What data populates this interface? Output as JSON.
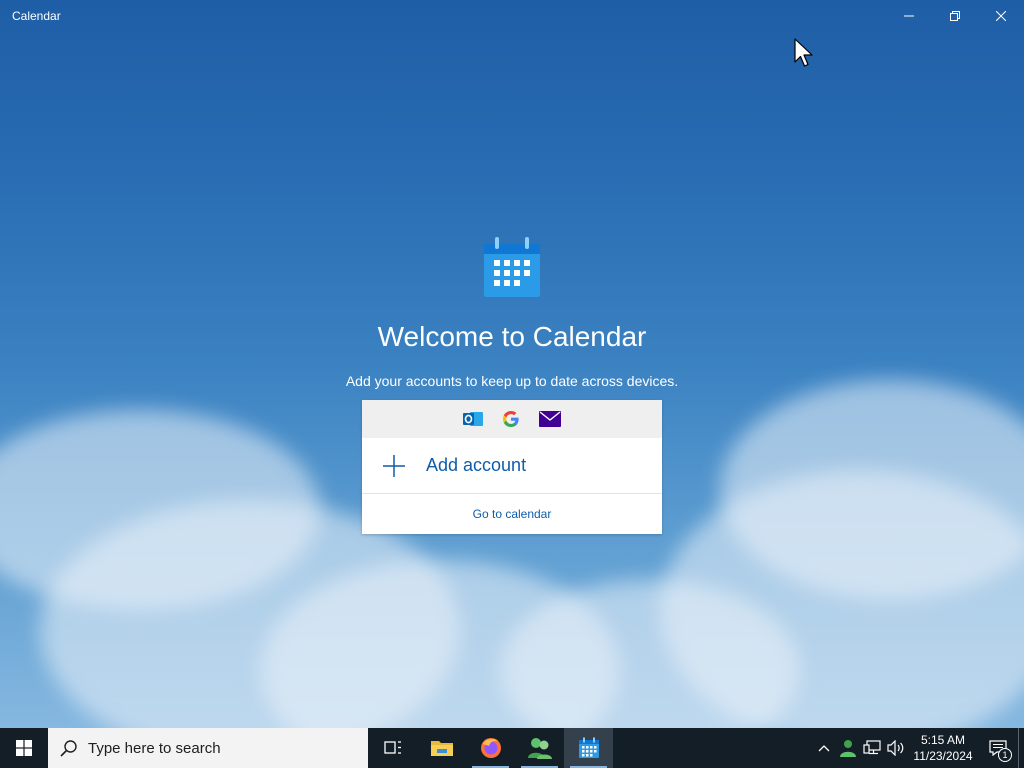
{
  "window": {
    "title": "Calendar",
    "controls": [
      "minimize-icon",
      "restore-icon",
      "close-icon"
    ]
  },
  "welcome": {
    "title": "Welcome to Calendar",
    "subtitle": "Add your accounts to keep up to date across devices."
  },
  "card": {
    "provider_icons": [
      "outlook-icon",
      "google-icon",
      "mail-icon"
    ],
    "add_account_label": "Add account",
    "go_to_calendar_label": "Go to calendar"
  },
  "taskbar": {
    "search_placeholder": "Type here to search",
    "pinned": [
      "task-view-icon",
      "file-explorer-icon",
      "firefox-icon",
      "people-app-icon",
      "calendar-app-icon"
    ],
    "active_app": "calendar-app-icon",
    "tray_icons": [
      "chevron-up-icon",
      "user-icon",
      "network-icon",
      "volume-icon"
    ],
    "clock": {
      "time": "5:15 AM",
      "date": "11/23/2024"
    },
    "notification_count": "1"
  },
  "colors": {
    "accent": "#0e5cab",
    "taskbar": "#141e27",
    "sky_top": "#1e5ea6"
  }
}
